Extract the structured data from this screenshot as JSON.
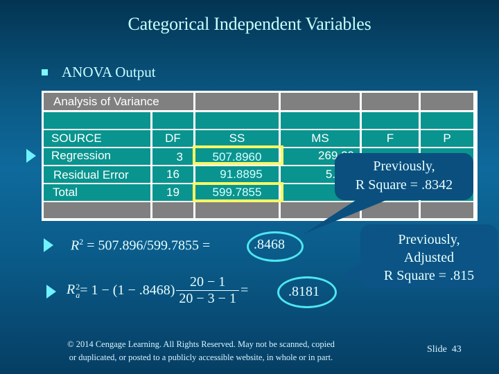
{
  "slide": {
    "title": "Categorical Independent Variables",
    "bullet": "ANOVA Output",
    "number_label": "Slide",
    "number": "43"
  },
  "anova_table": {
    "title": "Analysis of Variance",
    "columns": [
      "SOURCE",
      "DF",
      "SS",
      "MS",
      "F",
      "P"
    ],
    "rows": [
      {
        "source": "Regression",
        "df": "3",
        "ss": "507.8960",
        "ms": "269.29",
        "f": "",
        "p": ""
      },
      {
        "source": "Residual Error",
        "df": "16",
        "ss": "91.8895",
        "ms": "5.74",
        "f": "",
        "p": ""
      },
      {
        "source": "Total",
        "df": "19",
        "ss": "599.7855",
        "ms": "",
        "f": "",
        "p": ""
      }
    ],
    "highlight_color": "#f8f866"
  },
  "equations": {
    "r2_lhs": "R",
    "r2_sup": "2",
    "r2_expr": " = 507.896/599.7855 = ",
    "r2_result": ".8468",
    "adj_lhs": "R",
    "adj_sup": "2",
    "adj_sub": "a",
    "adj_expr": " = 1 − (1 − .8468)",
    "adj_num": "20 − 1",
    "adj_den": "20 − 3 − 1",
    "adj_eq": " = ",
    "adj_result": ".8181"
  },
  "callouts": {
    "r_square": {
      "line1": "Previously,",
      "line2": "R Square = .8342"
    },
    "adj_r_square": {
      "line1": "Previously,",
      "line2": "Adjusted",
      "line3": "R Square = .815"
    }
  },
  "footer": {
    "line1": "© 2014  Cengage Learning.  All Rights Reserved.  May not be scanned, copied",
    "line2": "or duplicated, or posted to a publicly accessible website, in whole or in part."
  }
}
